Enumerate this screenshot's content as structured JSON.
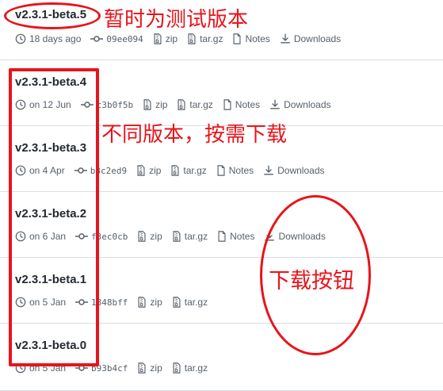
{
  "releases": [
    {
      "tag": "v2.3.1-beta.5",
      "date": "18 days ago",
      "commit": "09ee094",
      "zip": "zip",
      "tar": "tar.gz",
      "notes": "Notes",
      "downloads": "Downloads"
    },
    {
      "tag": "v2.3.1-beta.4",
      "date": "on 12 Jun",
      "commit": "c3b0f5b",
      "zip": "zip",
      "tar": "tar.gz",
      "notes": "Notes",
      "downloads": "Downloads"
    },
    {
      "tag": "v2.3.1-beta.3",
      "date": "on 4 Apr",
      "commit": "b3c2ed9",
      "zip": "zip",
      "tar": "tar.gz",
      "notes": "Notes",
      "downloads": "Downloads"
    },
    {
      "tag": "v2.3.1-beta.2",
      "date": "on 6 Jan",
      "commit": "f3ec0cb",
      "zip": "zip",
      "tar": "tar.gz",
      "notes": "Notes",
      "downloads": "Downloads"
    },
    {
      "tag": "v2.3.1-beta.1",
      "date": "on 5 Jan",
      "commit": "1848bff",
      "zip": "zip",
      "tar": "tar.gz"
    },
    {
      "tag": "v2.3.1-beta.0",
      "date": "on 5 Jan",
      "commit": "b93b4cf",
      "zip": "zip",
      "tar": "tar.gz"
    }
  ],
  "annotations": {
    "temporary": "暂时为测试版本",
    "versions": "不同版本，按需下载",
    "button": "下载按钮"
  },
  "colors": {
    "annotation": "#e8141b",
    "text": "#24292f",
    "muted": "#57606a",
    "border": "#d8dee4"
  }
}
